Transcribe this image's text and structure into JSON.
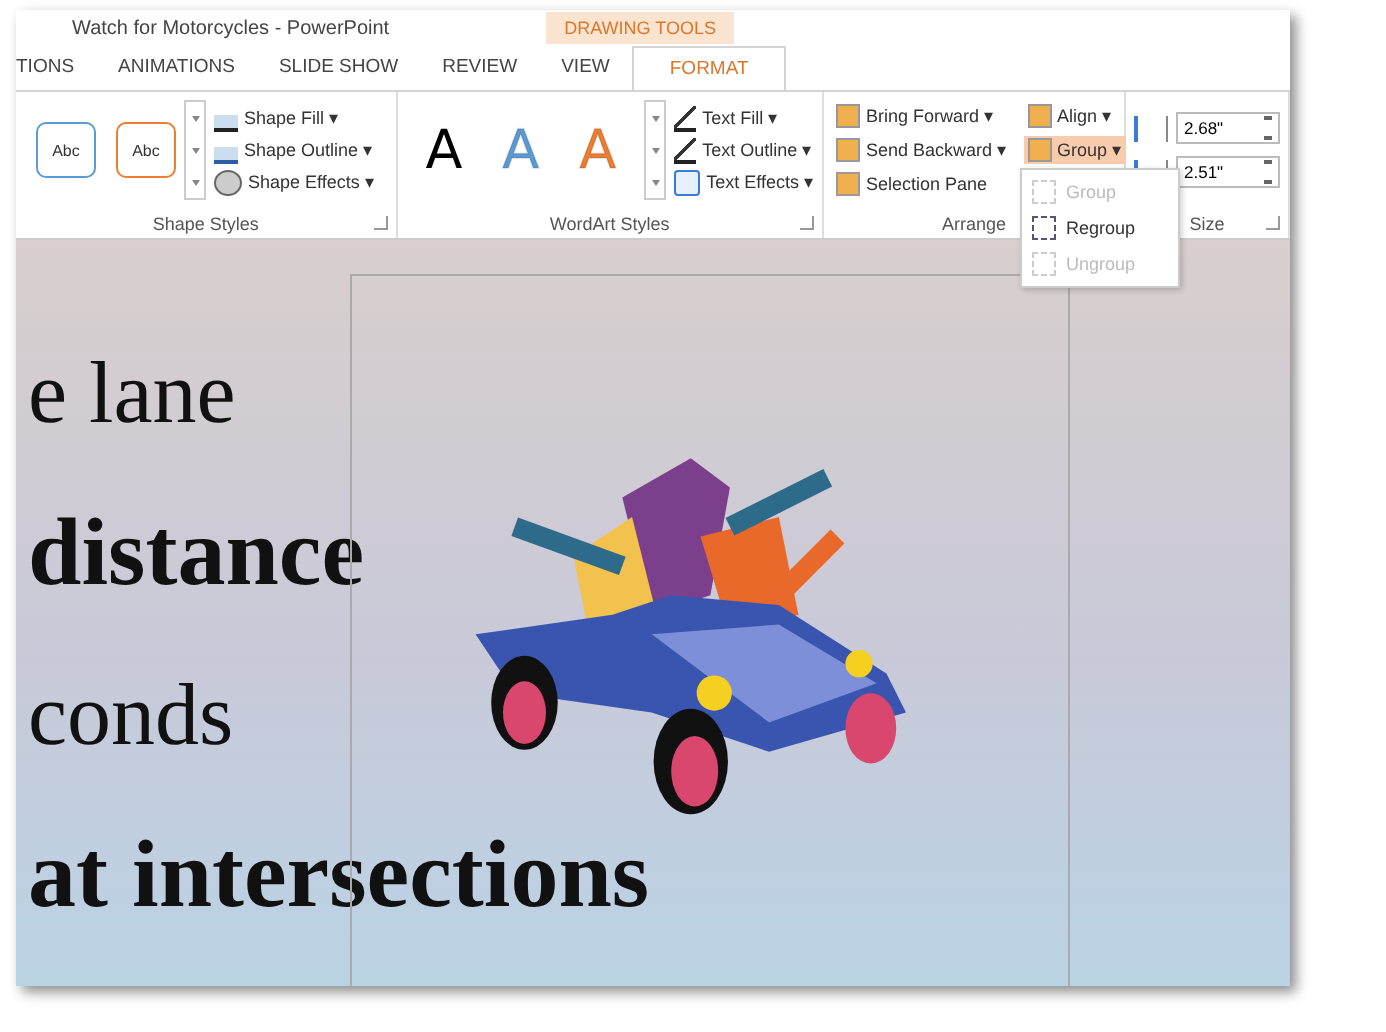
{
  "window": {
    "title": "Watch for Motorcycles - PowerPoint",
    "contextual_tab": "DRAWING TOOLS"
  },
  "tabs": [
    {
      "label": "TIONS",
      "selected": false
    },
    {
      "label": "ANIMATIONS",
      "selected": false
    },
    {
      "label": "SLIDE SHOW",
      "selected": false
    },
    {
      "label": "REVIEW",
      "selected": false
    },
    {
      "label": "VIEW",
      "selected": false
    },
    {
      "label": "FORMAT",
      "selected": true
    }
  ],
  "shape_styles": {
    "label": "Shape Styles",
    "swatches": [
      {
        "label": "Abc",
        "color": "#5b9bd5"
      },
      {
        "label": "Abc",
        "color": "#ed7d31"
      }
    ],
    "commands": [
      "Shape Fill ▾",
      "Shape Outline ▾",
      "Shape Effects ▾"
    ]
  },
  "wordart_styles": {
    "label": "WordArt Styles",
    "letters": [
      {
        "label": "A",
        "color": "#000000"
      },
      {
        "label": "A",
        "color": "#5b9bd5"
      },
      {
        "label": "A",
        "color": "#ed7d31"
      }
    ],
    "commands": [
      "Text Fill ▾",
      "Text Outline ▾",
      "Text Effects ▾"
    ]
  },
  "arrange": {
    "label": "Arrange",
    "commands": [
      {
        "label": "Bring Forward",
        "arrow": "▾",
        "selected": false
      },
      {
        "label": "Align ▾",
        "selected": false
      },
      {
        "label": "Send Backward",
        "arrow": "▾",
        "selected": false
      },
      {
        "label": "Group ▾",
        "selected": true
      },
      {
        "label": "Selection Pane",
        "selected": false
      }
    ]
  },
  "size": {
    "label": "Size",
    "height": "2.68\"",
    "width": "2.51\""
  },
  "group_menu": [
    {
      "label": "Group",
      "disabled": true
    },
    {
      "label": "Regroup",
      "disabled": false
    },
    {
      "label": "Ungroup",
      "disabled": true
    }
  ],
  "slide": {
    "lines": [
      {
        "text": "e lane",
        "bold": false
      },
      {
        "text": "distance",
        "bold": true
      },
      {
        "text": "conds",
        "bold": false
      },
      {
        "text": "at intersections",
        "bold": true
      }
    ]
  }
}
